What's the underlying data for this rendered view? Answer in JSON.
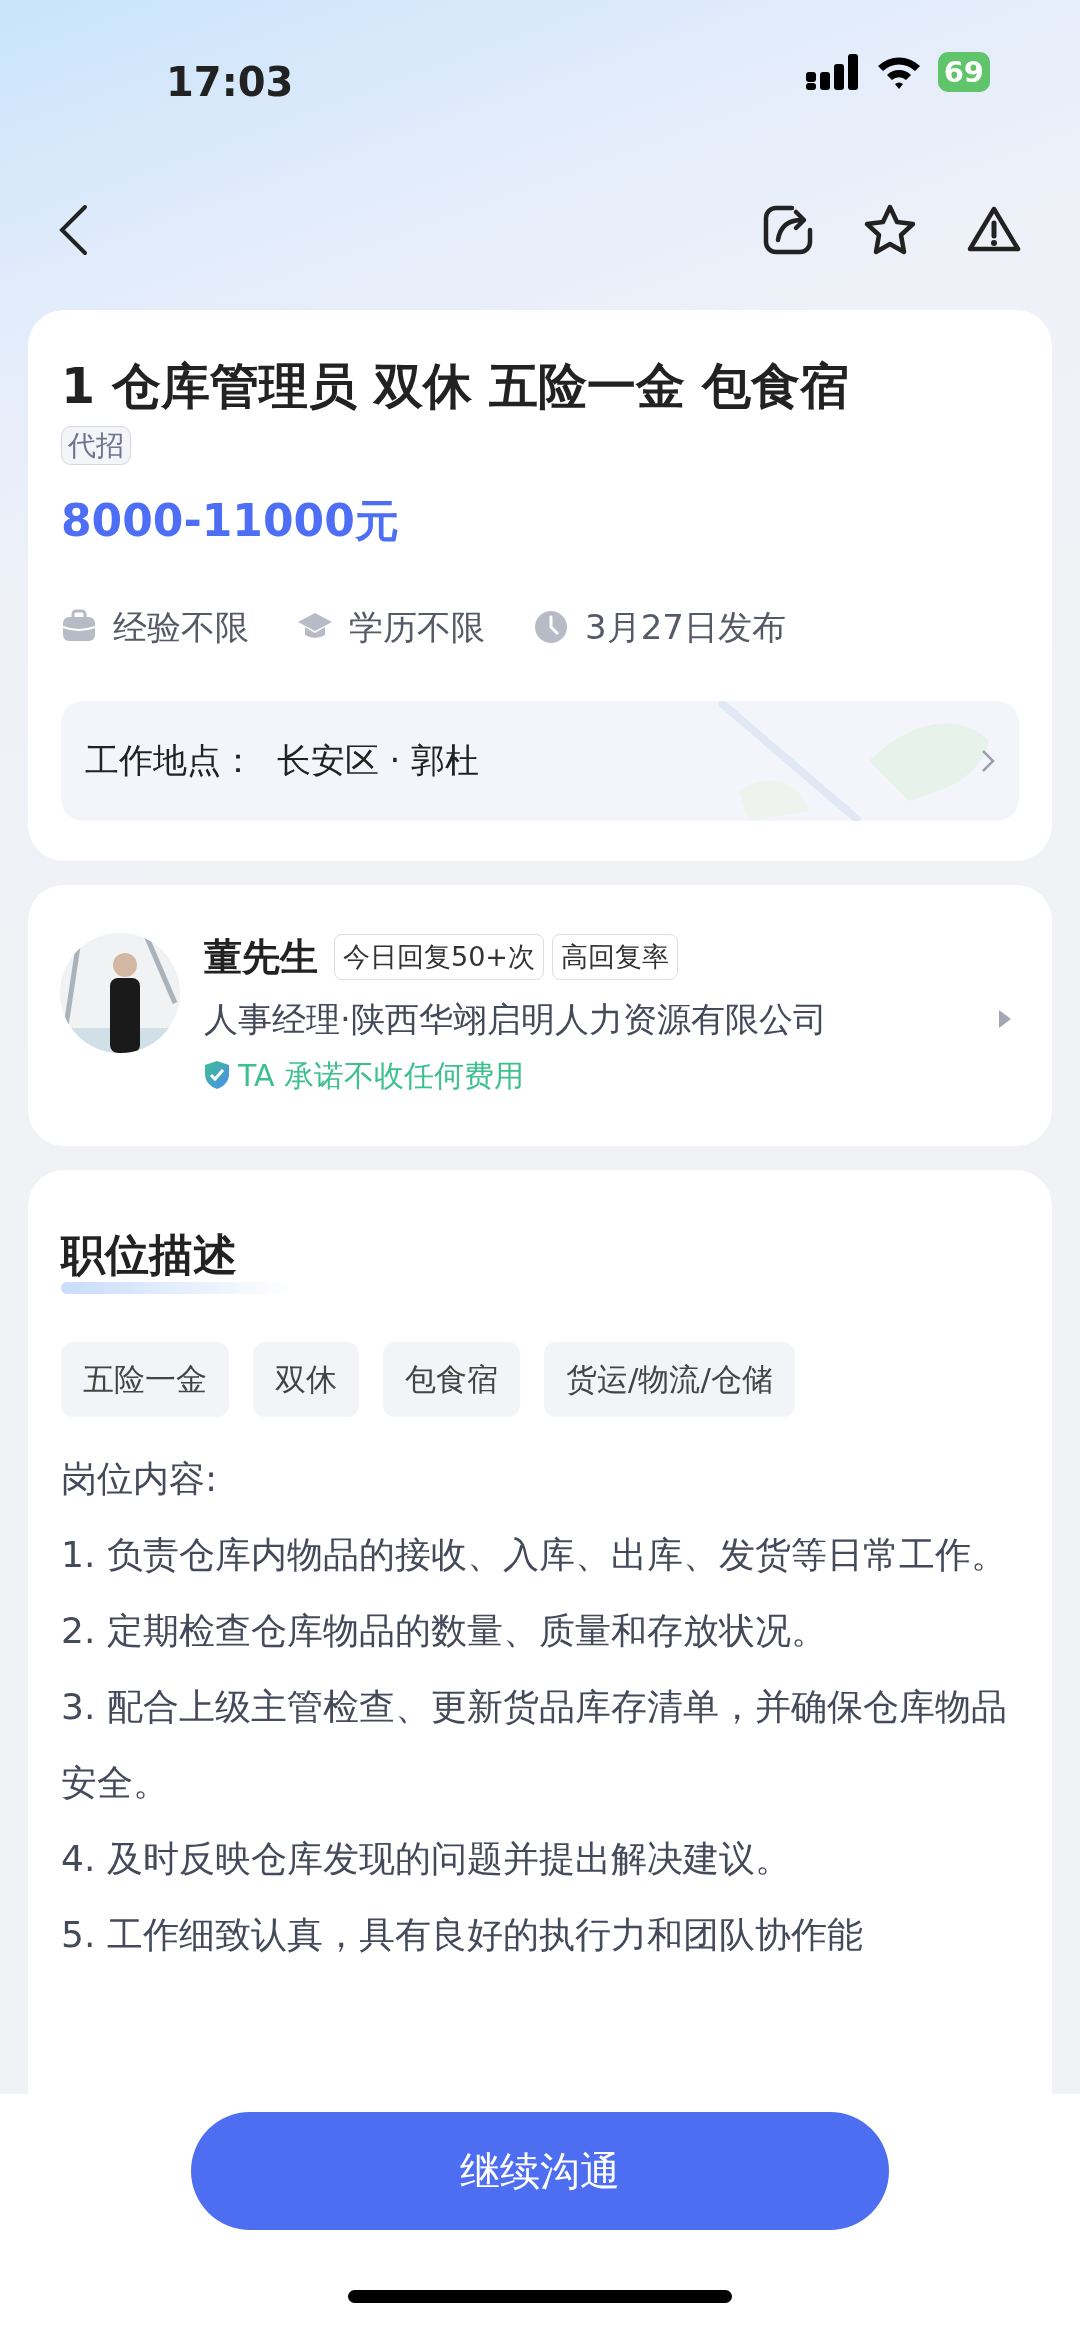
{
  "status_bar": {
    "time": "17:03",
    "battery": "69"
  },
  "job": {
    "title": "1 仓库管理员 双休 五险一金 包食宿",
    "tag": "代招",
    "salary": "8000-11000元",
    "meta": [
      {
        "kind": "experience",
        "text": "经验不限"
      },
      {
        "kind": "education",
        "text": "学历不限"
      },
      {
        "kind": "time",
        "text": "3月27日发布"
      }
    ],
    "location": {
      "label": "工作地点：",
      "value": "长安区 · 郭杜"
    }
  },
  "recruiter": {
    "avatar": {
      "kind": "picture"
    },
    "name": "董先生",
    "badges": [
      "今日回复50+次",
      "高回复率"
    ],
    "role": "人事经理·陕西华翊启明人力资源有限公司",
    "promise": "TA 承诺不收任何费用"
  },
  "description": {
    "heading": "职位描述",
    "tags": [
      "五险一金",
      "双休",
      "包食宿",
      "货运/物流/仓储"
    ],
    "lines": [
      "岗位内容:",
      "1. 负责仓库内物品的接收、入库、出库、发货等日常工作。",
      "2. 定期检查仓库物品的数量、质量和存放状况。",
      "3. 配合上级主管检查、更新货品库存清单，并确保仓库物品安全。",
      "4. 及时反映仓库发现的问题并提出解决建议。",
      "5. 工作细致认真，具有良好的执行力和团队协作能"
    ]
  },
  "action_button": "继续沟通"
}
